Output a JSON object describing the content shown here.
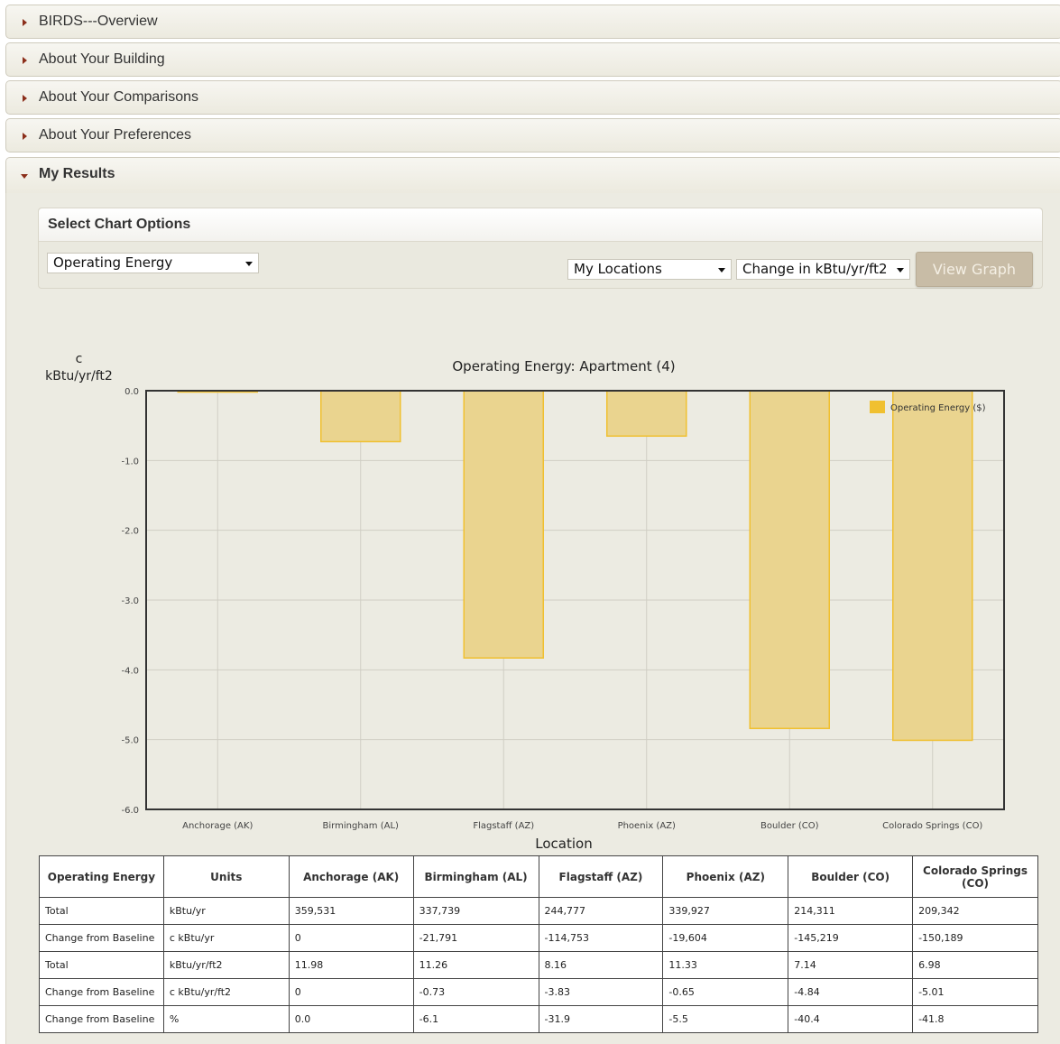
{
  "accordion": [
    {
      "label": "BIRDS---Overview",
      "open": false
    },
    {
      "label": "About Your Building",
      "open": false
    },
    {
      "label": "About Your Comparisons",
      "open": false
    },
    {
      "label": "About Your Preferences",
      "open": false
    },
    {
      "label": "My Results",
      "open": true
    }
  ],
  "options": {
    "title": "Select Chart Options",
    "metric_select": "Operating Energy",
    "locations_select": "My Locations",
    "units_select": "Change in kBtu/yr/ft2",
    "view_button": "View Graph"
  },
  "colors": {
    "bar_fill": "#ead48f",
    "bar_stroke": "#f0c030",
    "legend_swatch": "#f0c030",
    "panel_bg": "#ecebe2",
    "plot_bg": "#ecebe2",
    "accent": "#8b2e1a"
  },
  "chart_data": {
    "type": "bar",
    "title": "Operating Energy: Apartment (4)",
    "ylabel_line1": "c",
    "ylabel_line2": "kBtu/yr/ft2",
    "xlabel": "Location",
    "categories": [
      "Anchorage (AK)",
      "Birmingham (AL)",
      "Flagstaff (AZ)",
      "Phoenix (AZ)",
      "Boulder (CO)",
      "Colorado Springs (CO)"
    ],
    "series": [
      {
        "name": "Operating Energy ($)",
        "values": [
          0,
          -0.73,
          -3.83,
          -0.65,
          -4.84,
          -5.01
        ]
      }
    ],
    "ylim": [
      -6.0,
      0.0
    ],
    "yticks": [
      "0.0",
      "-1.0",
      "-2.0",
      "-3.0",
      "-4.0",
      "-5.0",
      "-6.0"
    ],
    "grid": true,
    "legend_position": "top-right"
  },
  "table": {
    "headers": [
      "Operating Energy",
      "Units",
      "Anchorage (AK)",
      "Birmingham (AL)",
      "Flagstaff (AZ)",
      "Phoenix (AZ)",
      "Boulder (CO)",
      "Colorado Springs (CO)"
    ],
    "rows": [
      [
        "Total",
        "kBtu/yr",
        "359,531",
        "337,739",
        "244,777",
        "339,927",
        "214,311",
        "209,342"
      ],
      [
        "Change from Baseline",
        "c kBtu/yr",
        "0",
        "-21,791",
        "-114,753",
        "-19,604",
        "-145,219",
        "-150,189"
      ],
      [
        "Total",
        "kBtu/yr/ft2",
        "11.98",
        "11.26",
        "8.16",
        "11.33",
        "7.14",
        "6.98"
      ],
      [
        "Change from Baseline",
        "c kBtu/yr/ft2",
        "0",
        "-0.73",
        "-3.83",
        "-0.65",
        "-4.84",
        "-5.01"
      ],
      [
        "Change from Baseline",
        "%",
        "0.0",
        "-6.1",
        "-31.9",
        "-5.5",
        "-40.4",
        "-41.8"
      ]
    ]
  }
}
